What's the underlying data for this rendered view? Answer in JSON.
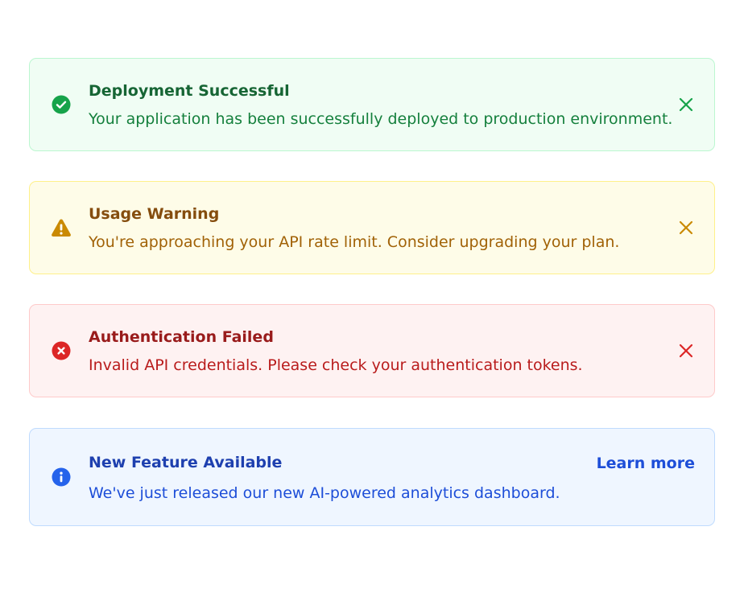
{
  "alerts": [
    {
      "type": "success",
      "icon": "check-circle-icon",
      "color": "#16a34a",
      "title": "Deployment Successful",
      "message": "Your application has been successfully deployed to production environment.",
      "dismiss_icon": "close-icon"
    },
    {
      "type": "warning",
      "icon": "warning-triangle-icon",
      "color": "#ca8a04",
      "title": "Usage Warning",
      "message": "You're approaching your API rate limit. Consider upgrading your plan.",
      "dismiss_icon": "close-icon"
    },
    {
      "type": "error",
      "icon": "x-circle-icon",
      "color": "#dc2626",
      "title": "Authentication Failed",
      "message": "Invalid API credentials. Please check your authentication tokens.",
      "dismiss_icon": "close-icon"
    },
    {
      "type": "info",
      "icon": "info-circle-icon",
      "color": "#2563eb",
      "title": "New Feature Available",
      "message": "We've just released our new AI-powered analytics dashboard.",
      "action_label": "Learn more"
    }
  ]
}
